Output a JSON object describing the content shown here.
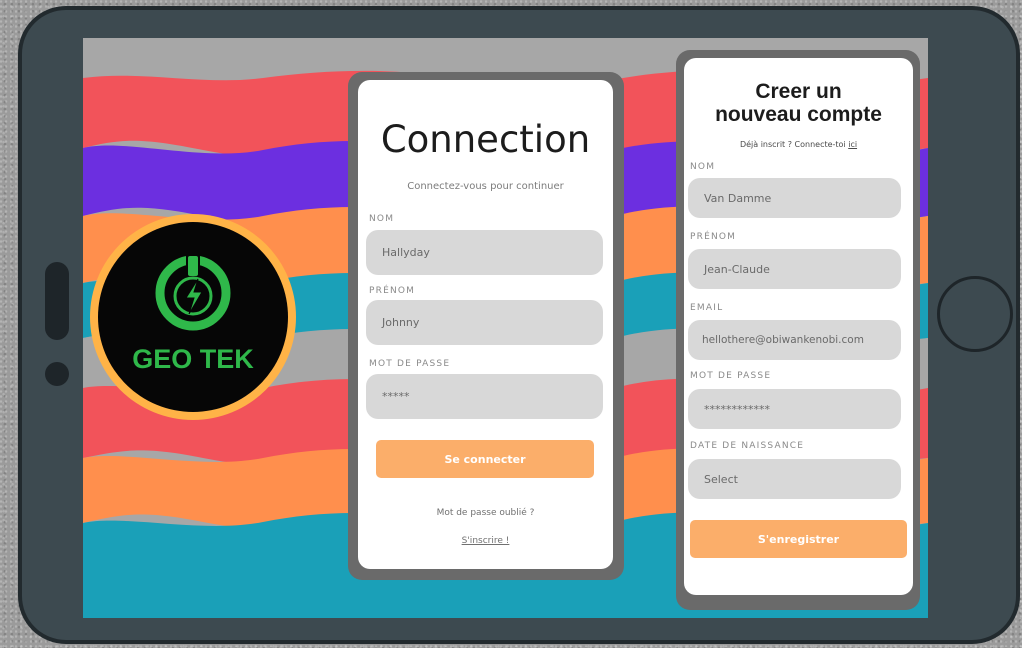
{
  "brand": {
    "logo_text": "GEO TEK",
    "accent": "#2fb84a"
  },
  "login": {
    "title": "Connection",
    "subtitle": "Connectez-vous pour continuer",
    "fields": [
      {
        "label": "NOM",
        "value": "Hallyday"
      },
      {
        "label": "PRÉNOM",
        "value": "Johnny"
      },
      {
        "label": "MOT DE PASSE",
        "value": "*****"
      }
    ],
    "submit_label": "Se connecter",
    "forgot_label": "Mot de passe oublié ?",
    "signup_label": "S'inscrire !"
  },
  "register": {
    "title_line1": "Creer un",
    "title_line2": "nouveau compte",
    "already_text": "Déjà inscrit ? Connecte-toi",
    "already_link": "ici",
    "fields": [
      {
        "label": "NOM",
        "value": "Van Damme"
      },
      {
        "label": "PRÉNOM",
        "value": "Jean-Claude"
      },
      {
        "label": "EMAIL",
        "value": "hellothere@obiwankenobi.com"
      },
      {
        "label": "MOT DE PASSE",
        "value": "************"
      },
      {
        "label": "DATE DE NAISSANCE",
        "value": "Select"
      }
    ],
    "submit_label": "S'enregistrer"
  },
  "colors": {
    "button": "#fbae6a",
    "field_bg": "#d8d8d8",
    "wave_red": "#f2535a",
    "wave_purple": "#6c2fe0",
    "wave_orange": "#ff8f4d",
    "wave_teal": "#1aa0b8"
  }
}
